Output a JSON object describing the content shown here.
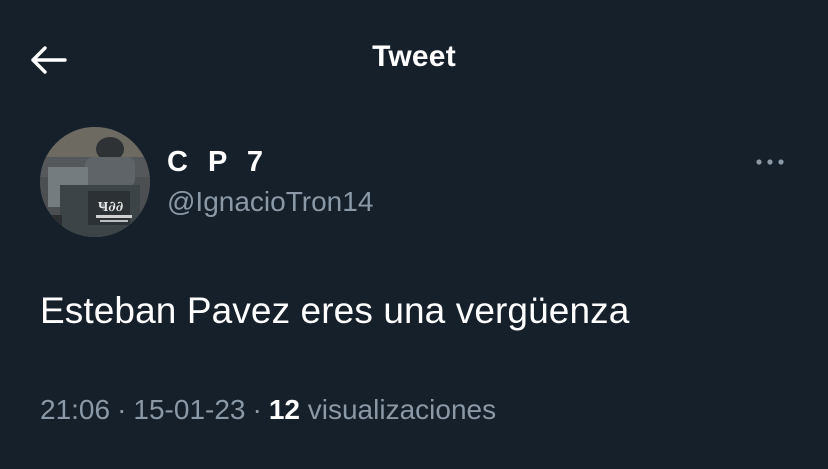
{
  "header": {
    "title": "Tweet",
    "back_icon": "arrow-left-icon"
  },
  "author": {
    "display_name": "C P 7",
    "handle": "@IgnacioTron14",
    "avatar_icon": "profile-avatar",
    "more_icon": "more-horizontal-icon"
  },
  "tweet": {
    "text": "Esteban Pavez eres una vergüenza"
  },
  "meta": {
    "time": "21:06",
    "separator": "·",
    "date": "15-01-23",
    "views_count": "12",
    "views_label": "visualizaciones"
  },
  "colors": {
    "background": "#15202b",
    "primary_text": "#ffffff",
    "secondary_text": "#8b98a5"
  }
}
